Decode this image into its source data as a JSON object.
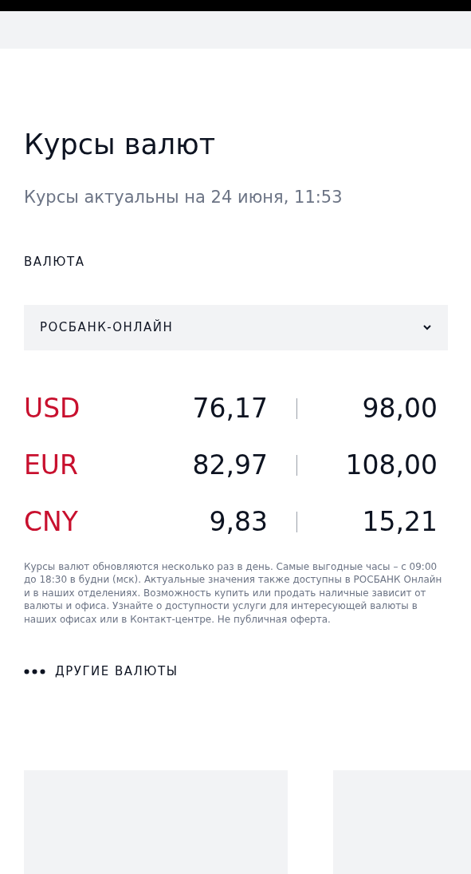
{
  "title": "Курсы валют",
  "subtitle": "Курсы актуальны на 24 июня, 11:53",
  "currency_label": "ВАЛЮТА",
  "dropdown": {
    "value": "РОСБАНК-ОНЛАЙН"
  },
  "rates": [
    {
      "code": "USD",
      "buy": "76,17",
      "sell": "98,00"
    },
    {
      "code": "EUR",
      "buy": "82,97",
      "sell": "108,00"
    },
    {
      "code": "CNY",
      "buy": "9,83",
      "sell": "15,21"
    }
  ],
  "note": "Курсы валют обновляются несколько раз в день. Самые выгодные часы – с 09:00 до 18:30 в будни (мск). Актуальные значения также доступны в РОСБАНК Онлайн и в наших отделениях. Возможность купить или продать наличные зависит от валюты и офиса. Узнайте о доступности услуги для интересующей валюты в наших офисах или в Контакт-центре.  Не публичная оферта.",
  "other_currencies_link": "ДРУГИЕ ВАЛЮТЫ"
}
